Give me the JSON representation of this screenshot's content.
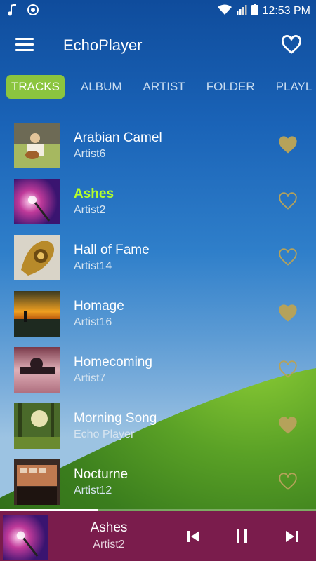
{
  "status_bar": {
    "time": "12:53 PM",
    "left_icons": [
      "music-note-icon",
      "sync-icon"
    ],
    "right_icons": [
      "wifi-icon",
      "signal-icon",
      "battery-icon"
    ]
  },
  "app_bar": {
    "title": "EchoPlayer",
    "menu_icon": "hamburger-menu-icon",
    "favorite_icon": "heart-outline-icon"
  },
  "tabs": [
    {
      "label": "TRACKS",
      "active": true
    },
    {
      "label": "ALBUM",
      "active": false
    },
    {
      "label": "ARTIST",
      "active": false
    },
    {
      "label": "FOLDER",
      "active": false
    },
    {
      "label": "PLAYL",
      "active": false
    }
  ],
  "tracks": [
    {
      "title": "Arabian Camel",
      "artist": "Artist6",
      "favorite": true,
      "playing": false
    },
    {
      "title": "Ashes",
      "artist": "Artist2",
      "favorite": false,
      "playing": true
    },
    {
      "title": "Hall of Fame",
      "artist": "Artist14",
      "favorite": false,
      "playing": false
    },
    {
      "title": "Homage",
      "artist": "Artist16",
      "favorite": true,
      "playing": false
    },
    {
      "title": "Homecoming",
      "artist": "Artist7",
      "favorite": false,
      "playing": false
    },
    {
      "title": "Morning Song",
      "artist": "Echo Player",
      "favorite": true,
      "playing": false
    },
    {
      "title": "Nocturne",
      "artist": "Artist12",
      "favorite": false,
      "playing": false
    }
  ],
  "now_playing": {
    "title": "Ashes",
    "artist": "Artist2",
    "progress": 0.31,
    "controls": [
      "previous-icon",
      "pause-icon",
      "next-icon"
    ]
  },
  "colors": {
    "accent": "#8bc53f",
    "playing_title": "#b5ff2a",
    "heart": "#b5a25a",
    "player_bar": "#7a1c4c"
  }
}
